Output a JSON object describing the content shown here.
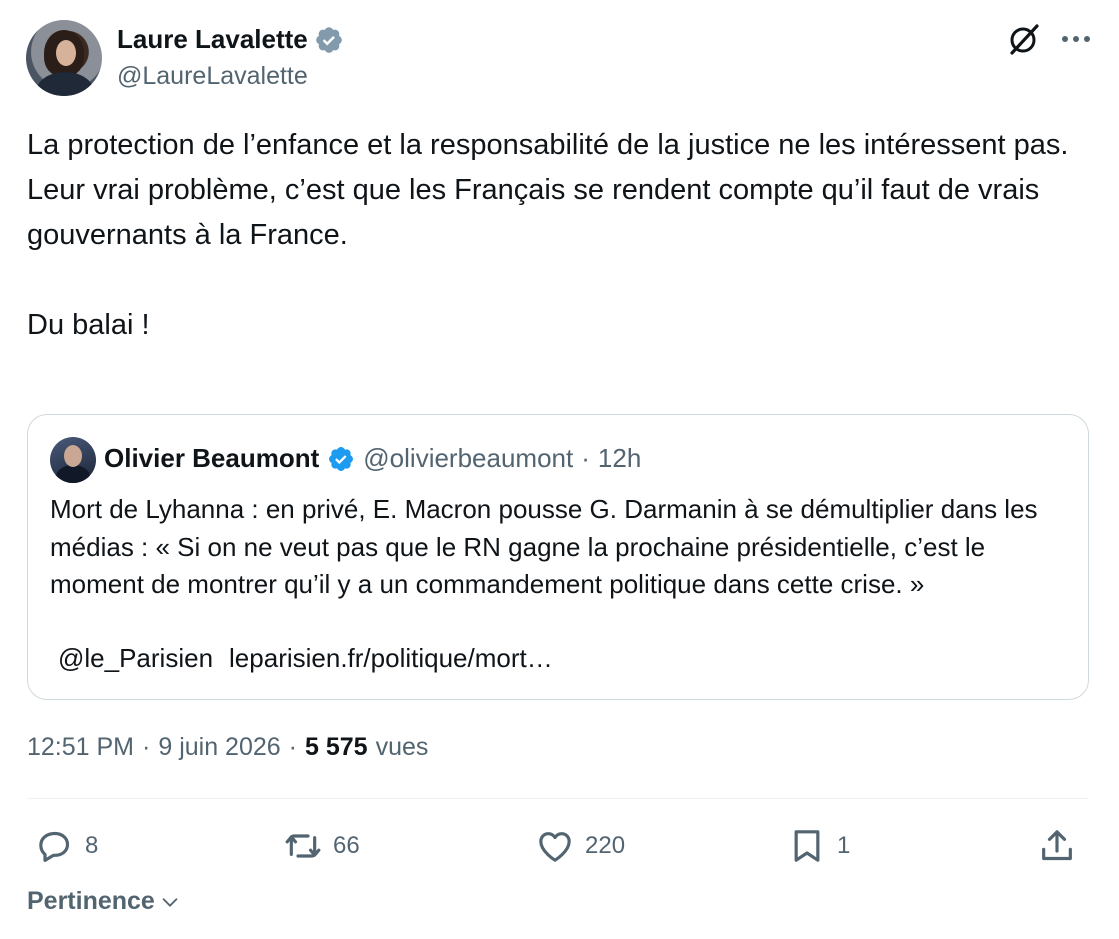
{
  "tweet": {
    "author": {
      "name": "Laure Lavalette",
      "handle": "@LaureLavalette"
    },
    "paragraphs": [
      "La protection de l’enfance et la responsabilité de la justice ne les intéressent pas.\nLeur vrai problème, c’est que les Français se rendent compte qu’il faut de vrais gouvernants à la France.",
      "Du balai !"
    ],
    "quote": {
      "name": "Olivier Beaumont",
      "handle": "@olivierbeaumont",
      "separator": "·",
      "time": "12h",
      "text": "Mort de Lyhanna : en privé, E. Macron pousse G. Darmanin à se démultiplier dans les médias : « Si on ne veut pas que le RN gagne la prochaine présidentielle, c’est le moment de montrer qu’il y a un commandement politique dans cette crise. »",
      "mention": "@le_Parisien",
      "link": "leparisien.fr/politique/mort…"
    },
    "timestamp": "12:51 PM",
    "separator": "·",
    "date": "9 juin 2026",
    "views_count": "5 575",
    "views_label": "vues",
    "stats": {
      "replies": "8",
      "reposts": "66",
      "likes": "220",
      "bookmarks": "1"
    },
    "sort_label": "Pertinence"
  },
  "colors": {
    "verified": "#1d9bf0",
    "text": "#0f1419",
    "secondary": "#536471",
    "border": "#cfd9de"
  },
  "icons": {
    "verified": "verified-badge-icon",
    "grok": "grok-icon",
    "more": "more-icon",
    "reply": "reply-icon",
    "repost": "repost-icon",
    "like": "heart-icon",
    "bookmark": "bookmark-icon",
    "share": "share-icon",
    "sort": "chevron-down-icon"
  }
}
